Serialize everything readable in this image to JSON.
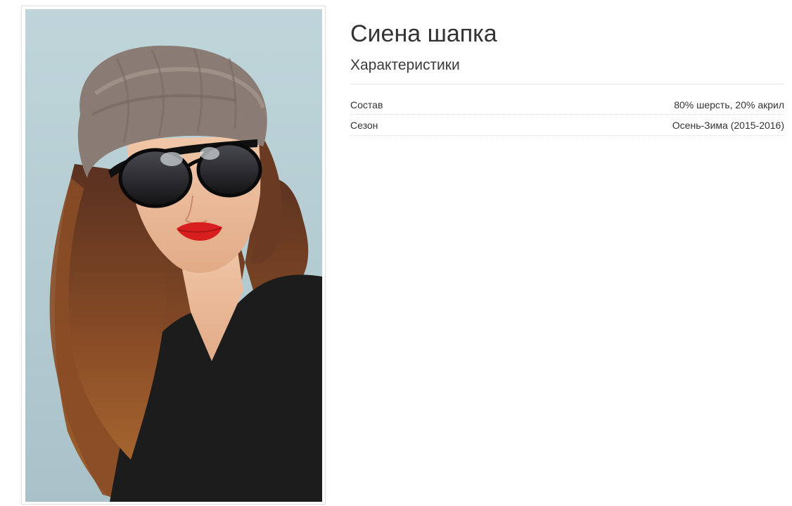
{
  "product": {
    "title": "Сиена шапка",
    "image_alt": "woman wearing knitted beanie and sunglasses"
  },
  "characteristics": {
    "heading": "Характеристики",
    "rows": [
      {
        "label": "Состав",
        "value": "80% шерсть, 20% акрил"
      },
      {
        "label": "Сезон",
        "value": "Осень-Зима (2015-2016)"
      }
    ]
  },
  "colors": {
    "photo_background": "#b9d0d6",
    "hat": "#8a7c74",
    "hair": "#7a4526",
    "sweater": "#1c1c1c",
    "lips": "#d81f1f"
  }
}
